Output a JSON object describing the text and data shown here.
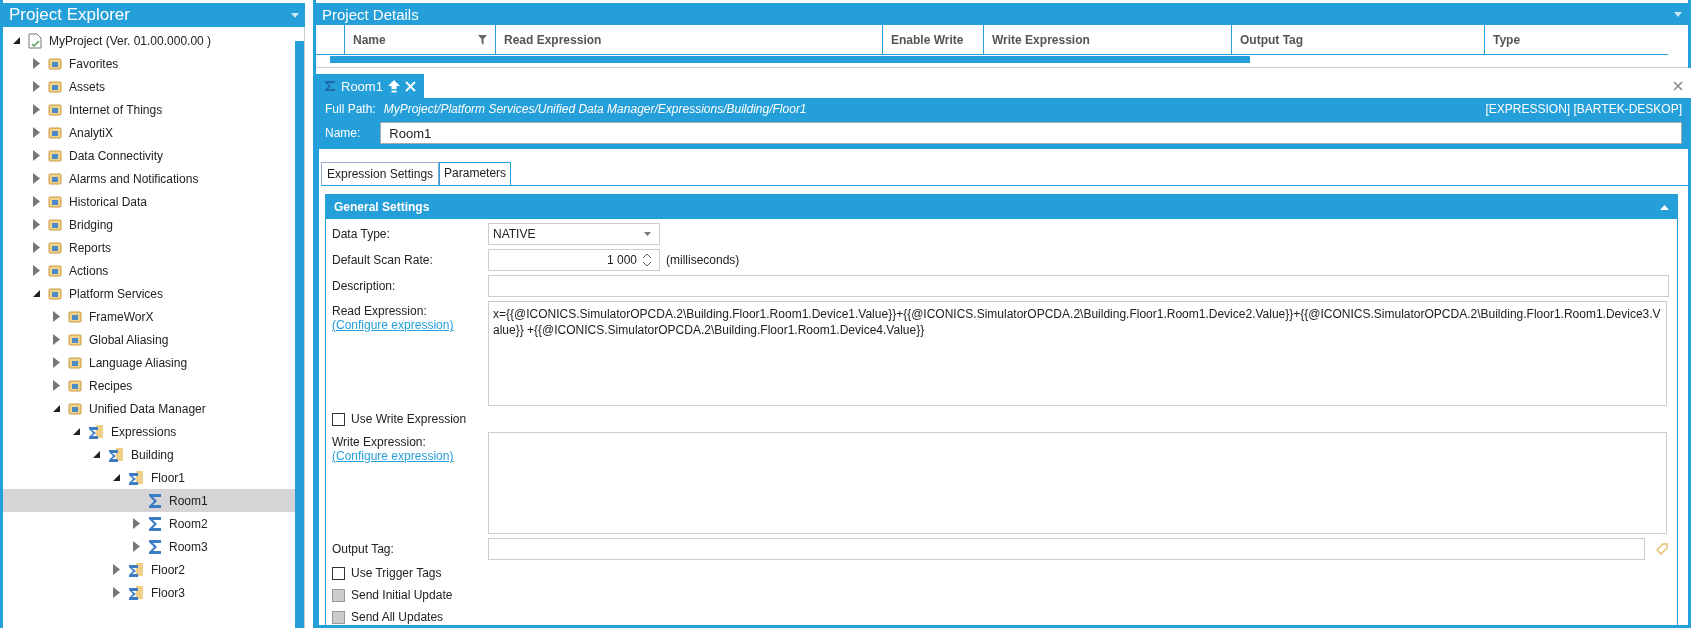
{
  "explorer": {
    "title": "Project Explorer",
    "tree": [
      {
        "label": "MyProject (Ver. 01.00.000.00 )",
        "kind": "project",
        "expanded": true,
        "selected": false,
        "children": [
          {
            "label": "Favorites",
            "kind": "module",
            "expanded": false,
            "selected": false
          },
          {
            "label": "Assets",
            "kind": "module",
            "expanded": false,
            "selected": false
          },
          {
            "label": "Internet of Things",
            "kind": "module",
            "expanded": false,
            "selected": false
          },
          {
            "label": "AnalytiX",
            "kind": "module",
            "expanded": false,
            "selected": false
          },
          {
            "label": "Data Connectivity",
            "kind": "module",
            "expanded": false,
            "selected": false
          },
          {
            "label": "Alarms and Notifications",
            "kind": "module",
            "expanded": false,
            "selected": false
          },
          {
            "label": "Historical Data",
            "kind": "module",
            "expanded": false,
            "selected": false
          },
          {
            "label": "Bridging",
            "kind": "module",
            "expanded": false,
            "selected": false
          },
          {
            "label": "Reports",
            "kind": "module",
            "expanded": false,
            "selected": false
          },
          {
            "label": "Actions",
            "kind": "module",
            "expanded": false,
            "selected": false
          },
          {
            "label": "Platform Services",
            "kind": "module",
            "expanded": true,
            "selected": false,
            "children": [
              {
                "label": "FrameWorX",
                "kind": "module",
                "expanded": false,
                "selected": false
              },
              {
                "label": "Global Aliasing",
                "kind": "module",
                "expanded": false,
                "selected": false
              },
              {
                "label": "Language Aliasing",
                "kind": "module",
                "expanded": false,
                "selected": false
              },
              {
                "label": "Recipes",
                "kind": "module",
                "expanded": false,
                "selected": false
              },
              {
                "label": "Unified Data Manager",
                "kind": "module",
                "expanded": true,
                "selected": false,
                "children": [
                  {
                    "label": "Expressions",
                    "kind": "folder",
                    "expanded": true,
                    "selected": false,
                    "children": [
                      {
                        "label": "Building",
                        "kind": "folder",
                        "expanded": true,
                        "selected": false,
                        "children": [
                          {
                            "label": "Floor1",
                            "kind": "folder",
                            "expanded": true,
                            "selected": false,
                            "children": [
                              {
                                "label": "Room1",
                                "kind": "expression",
                                "selected": true
                              },
                              {
                                "label": "Room2",
                                "kind": "expression",
                                "expanded": false,
                                "selected": false
                              },
                              {
                                "label": "Room3",
                                "kind": "expression",
                                "expanded": false,
                                "selected": false
                              }
                            ]
                          },
                          {
                            "label": "Floor2",
                            "kind": "folder",
                            "expanded": false,
                            "selected": false
                          },
                          {
                            "label": "Floor3",
                            "kind": "folder",
                            "expanded": false,
                            "selected": false
                          }
                        ]
                      }
                    ]
                  }
                ]
              }
            ]
          }
        ]
      }
    ]
  },
  "details": {
    "title": "Project Details",
    "columns": [
      "Name",
      "Read Expression",
      "Enable Write",
      "Write Expression",
      "Output Tag",
      "Type"
    ]
  },
  "document": {
    "tab": "Room1",
    "full_path_label": "Full Path:",
    "full_path": "MyProject/Platform Services/Unified Data Manager/Expressions/Building/Floor1",
    "type_info": "[EXPRESSION] [BARTEK-DESKOP]",
    "name_label": "Name:",
    "name": "Room1",
    "tabs": [
      {
        "label": "Expression Settings",
        "selected": true
      },
      {
        "label": "Parameters",
        "selected": false
      }
    ],
    "section": "General Settings",
    "data_type": {
      "label": "Data Type:",
      "value": "NATIVE"
    },
    "scan_rate": {
      "label": "Default Scan Rate:",
      "value": "1 000",
      "unit": "(milliseconds)"
    },
    "description": {
      "label": "Description:"
    },
    "read_expression": {
      "label": "Read Expression:",
      "link": "(Configure expression)",
      "value": "x={{@ICONICS.SimulatorOPCDA.2\\Building.Floor1.Room1.Device1.Value}}+{{@ICONICS.SimulatorOPCDA.2\\Building.Floor1.Room1.Device2.Value}}+{{@ICONICS.SimulatorOPCDA.2\\Building.Floor1.Room1.Device3.Value}} +{{@ICONICS.SimulatorOPCDA.2\\Building.Floor1.Room1.Device4.Value}}"
    },
    "use_write": {
      "label": "Use Write Expression",
      "checked": false,
      "disabled": false
    },
    "write_expression": {
      "label": "Write Expression:",
      "link": "(Configure expression)"
    },
    "output_tag": {
      "label": "Output Tag:"
    },
    "options": [
      {
        "label": "Use Trigger Tags",
        "checked": false,
        "disabled": false
      },
      {
        "label": "Send Initial Update",
        "checked": false,
        "disabled": true
      },
      {
        "label": "Send All Updates",
        "checked": false,
        "disabled": true
      }
    ]
  }
}
